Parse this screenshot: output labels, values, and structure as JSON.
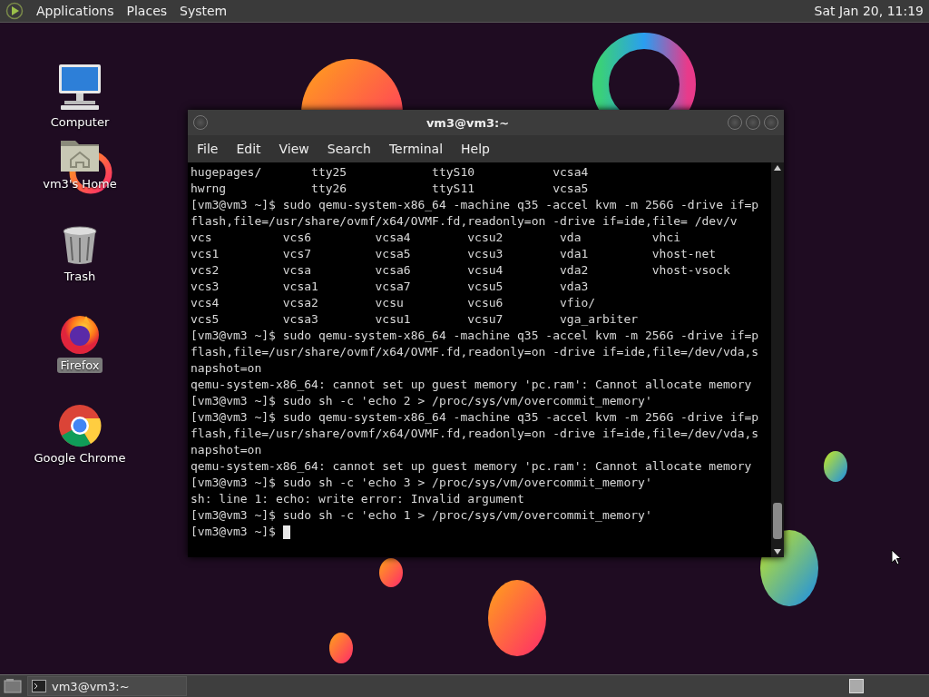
{
  "top_panel": {
    "menus": [
      {
        "label": "Applications"
      },
      {
        "label": "Places"
      },
      {
        "label": "System"
      }
    ],
    "clock": "Sat Jan 20, 11:19"
  },
  "desktop_icons": [
    {
      "label": "Computer",
      "kind": "computer",
      "selected": false
    },
    {
      "label": "vm3's Home",
      "kind": "home",
      "selected": false
    },
    {
      "label": "Trash",
      "kind": "trash",
      "selected": false
    },
    {
      "label": "Firefox",
      "kind": "firefox",
      "selected": true
    },
    {
      "label": "Google Chrome",
      "kind": "chrome",
      "selected": false
    }
  ],
  "terminal": {
    "title": "vm3@vm3:~",
    "menu": [
      "File",
      "Edit",
      "View",
      "Search",
      "Terminal",
      "Help"
    ],
    "lines": [
      "hugepages/       tty25            ttyS10           vcsa4",
      "hwrng            tty26            ttyS11           vcsa5",
      "[vm3@vm3 ~]$ sudo qemu-system-x86_64 -machine q35 -accel kvm -m 256G -drive if=p",
      "flash,file=/usr/share/ovmf/x64/OVMF.fd,readonly=on -drive if=ide,file= /dev/v",
      "vcs          vcs6         vcsa4        vcsu2        vda          vhci",
      "vcs1         vcs7         vcsa5        vcsu3        vda1         vhost-net",
      "vcs2         vcsa         vcsa6        vcsu4        vda2         vhost-vsock",
      "vcs3         vcsa1        vcsa7        vcsu5        vda3",
      "vcs4         vcsa2        vcsu         vcsu6        vfio/",
      "vcs5         vcsa3        vcsu1        vcsu7        vga_arbiter",
      "[vm3@vm3 ~]$ sudo qemu-system-x86_64 -machine q35 -accel kvm -m 256G -drive if=p",
      "flash,file=/usr/share/ovmf/x64/OVMF.fd,readonly=on -drive if=ide,file=/dev/vda,s",
      "napshot=on",
      "qemu-system-x86_64: cannot set up guest memory 'pc.ram': Cannot allocate memory",
      "[vm3@vm3 ~]$ sudo sh -c 'echo 2 > /proc/sys/vm/overcommit_memory'",
      "[vm3@vm3 ~]$ sudo qemu-system-x86_64 -machine q35 -accel kvm -m 256G -drive if=p",
      "flash,file=/usr/share/ovmf/x64/OVMF.fd,readonly=on -drive if=ide,file=/dev/vda,s",
      "napshot=on",
      "qemu-system-x86_64: cannot set up guest memory 'pc.ram': Cannot allocate memory",
      "[vm3@vm3 ~]$ sudo sh -c 'echo 3 > /proc/sys/vm/overcommit_memory'",
      "sh: line 1: echo: write error: Invalid argument",
      "[vm3@vm3 ~]$ sudo sh -c 'echo 1 > /proc/sys/vm/overcommit_memory'",
      "[vm3@vm3 ~]$"
    ],
    "cursor": true
  },
  "taskbar": {
    "tasks": [
      {
        "label": "vm3@vm3:~",
        "selected": false
      }
    ]
  }
}
